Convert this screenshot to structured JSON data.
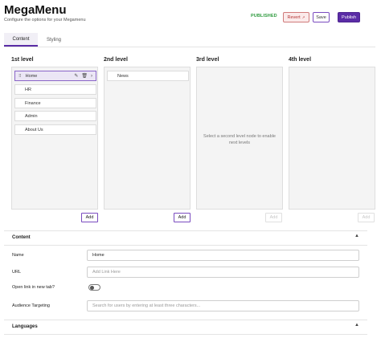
{
  "header": {
    "title": "MegaMenu",
    "subtitle": "Configure the options for your Megamenu",
    "status": "PUBLISHED",
    "revert_label": "Revert",
    "revert_icon": "external-link-icon",
    "save_label": "Save",
    "publish_label": "Publish"
  },
  "tabs": [
    {
      "label": "Content",
      "active": true
    },
    {
      "label": "Styling",
      "active": false
    }
  ],
  "levels": [
    {
      "title": "1st level",
      "add_label": "Add",
      "add_enabled": true
    },
    {
      "title": "2nd level",
      "add_label": "Add",
      "add_enabled": true
    },
    {
      "title": "3rd level",
      "add_label": "Add",
      "add_enabled": false,
      "message": "Select a second level node to enable next levels"
    },
    {
      "title": "4th level",
      "add_label": "Add",
      "add_enabled": false
    }
  ],
  "level1_items": [
    {
      "label": "Home",
      "selected": true
    },
    {
      "label": "HR"
    },
    {
      "label": "Finance"
    },
    {
      "label": "Admin"
    },
    {
      "label": "About Us"
    }
  ],
  "level2_items": [
    {
      "label": "News"
    }
  ],
  "content_section": {
    "title": "Content",
    "name_label": "Name",
    "name_value": "Home",
    "url_label": "URL",
    "url_placeholder": "Add Link Here",
    "new_tab_label": "Open link in new tab?",
    "new_tab_enabled": false,
    "audience_label": "Audience Targeting",
    "audience_placeholder": "Search for users by entering at least three characters..."
  },
  "languages_section": {
    "title": "Languages"
  },
  "colors": {
    "accent": "#5a2ca6",
    "published": "#2e9a3e",
    "revert": "#b43434"
  }
}
